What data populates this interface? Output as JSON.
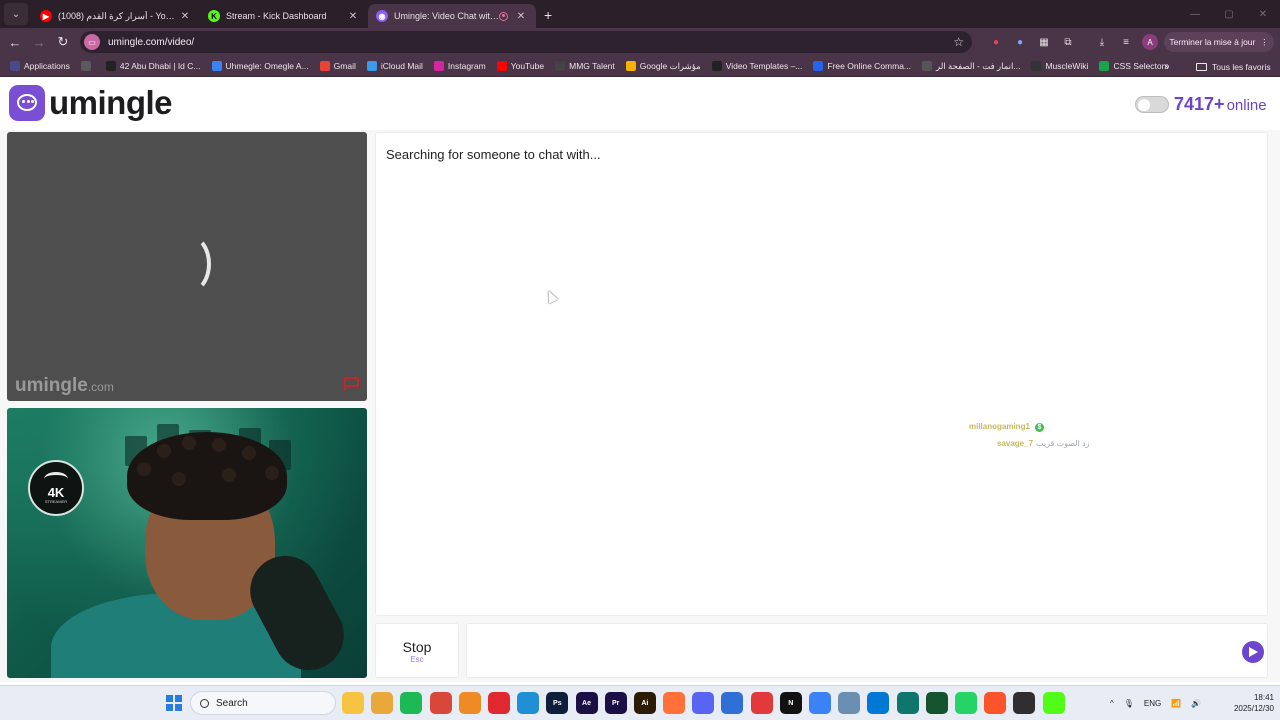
{
  "browser": {
    "tabs": [
      {
        "title": "(1008) أسرار كرة القدم - YouTube",
        "favicon_color": "#ff0000",
        "favicon_glyph": "▶"
      },
      {
        "title": "Stream - Kick Dashboard",
        "favicon_color": "#53fc18",
        "favicon_glyph": "K"
      },
      {
        "title": "Umingle: Video Chat with S",
        "favicon_color": "#8b5cf6",
        "favicon_glyph": "◉",
        "active": true
      }
    ],
    "new_tab_glyph": "+",
    "url": "umingle.com/video/",
    "update_button": "Terminer la mise à jour",
    "profile_initial": "A",
    "bookmarks": [
      {
        "label": "Applications",
        "color": "#4a4a8a"
      },
      {
        "label": "",
        "color": "#5a5a5a"
      },
      {
        "label": "42 Abu Dhabi | Id C...",
        "color": "#222222"
      },
      {
        "label": "Uhmegle: Omegle A...",
        "color": "#3b82f6"
      },
      {
        "label": "Gmail",
        "color": "#ea4335"
      },
      {
        "label": "iCloud Mail",
        "color": "#3b9be8"
      },
      {
        "label": "Instagram",
        "color": "#d6249f"
      },
      {
        "label": "YouTube",
        "color": "#ff0000"
      },
      {
        "label": "MMG Talent",
        "color": "#444444"
      },
      {
        "label": "Google مؤشرات",
        "color": "#f4b400"
      },
      {
        "label": "Video Templates –...",
        "color": "#222222"
      },
      {
        "label": "Free Online Comma...",
        "color": "#2563eb"
      },
      {
        "label": "انمار فت - الصفحة الر...",
        "color": "#555555"
      },
      {
        "label": "MuscleWiki",
        "color": "#333333"
      },
      {
        "label": "CSS Selectors",
        "color": "#16a34a"
      }
    ],
    "bookmarks_more": "»",
    "all_bookmarks": "Tous les favoris"
  },
  "site": {
    "brand": "umingle",
    "online_count": "7417+",
    "online_label": "online",
    "status_message": "Searching for someone to chat with...",
    "watermark": "umingle",
    "watermark_domain": ".com",
    "stop_label": "Stop",
    "stop_key": "Esc",
    "accent_color": "#6d46cf"
  },
  "stream_overlay": {
    "user1": "millanogaming1",
    "user2": "savage_7",
    "user2_message": "زد الصوت قريب"
  },
  "taskbar": {
    "search_label": "Search",
    "apps": [
      {
        "name": "file-explorer",
        "color": "#f6c342",
        "glyph": ""
      },
      {
        "name": "folder",
        "color": "#e8a93a",
        "glyph": ""
      },
      {
        "name": "spotify",
        "color": "#1db954",
        "glyph": ""
      },
      {
        "name": "chrome",
        "color": "#d9473a",
        "glyph": ""
      },
      {
        "name": "fl-studio",
        "color": "#f08a24",
        "glyph": ""
      },
      {
        "name": "opera",
        "color": "#e0292f",
        "glyph": ""
      },
      {
        "name": "edge",
        "color": "#1f8fd6",
        "glyph": ""
      },
      {
        "name": "photoshop",
        "color": "#0f1f3b",
        "glyph": "Ps"
      },
      {
        "name": "after-effects",
        "color": "#1a1045",
        "glyph": "Ae"
      },
      {
        "name": "premiere",
        "color": "#1a1045",
        "glyph": "Pr"
      },
      {
        "name": "illustrator",
        "color": "#2d1b05",
        "glyph": "Ai"
      },
      {
        "name": "firefox",
        "color": "#ff7139",
        "glyph": ""
      },
      {
        "name": "discord",
        "color": "#5865f2",
        "glyph": ""
      },
      {
        "name": "store",
        "color": "#2f6fd6",
        "glyph": ""
      },
      {
        "name": "app-red",
        "color": "#e23a3a",
        "glyph": ""
      },
      {
        "name": "netflix",
        "color": "#111111",
        "glyph": "N"
      },
      {
        "name": "app-blue",
        "color": "#3b82f6",
        "glyph": ""
      },
      {
        "name": "app-cloud",
        "color": "#6b8fb3",
        "glyph": ""
      },
      {
        "name": "vscode",
        "color": "#0078d4",
        "glyph": ""
      },
      {
        "name": "app-teal",
        "color": "#0f766e",
        "glyph": ""
      },
      {
        "name": "app-green",
        "color": "#14532d",
        "glyph": ""
      },
      {
        "name": "whatsapp-like",
        "color": "#25d366",
        "glyph": ""
      },
      {
        "name": "brave",
        "color": "#fb542b",
        "glyph": ""
      },
      {
        "name": "obs",
        "color": "#302e31",
        "glyph": ""
      },
      {
        "name": "kick",
        "color": "#53fc18",
        "glyph": ""
      }
    ],
    "tray_caret": "^",
    "language": "ENG",
    "time": "18:41",
    "date": "2025/12/30"
  }
}
